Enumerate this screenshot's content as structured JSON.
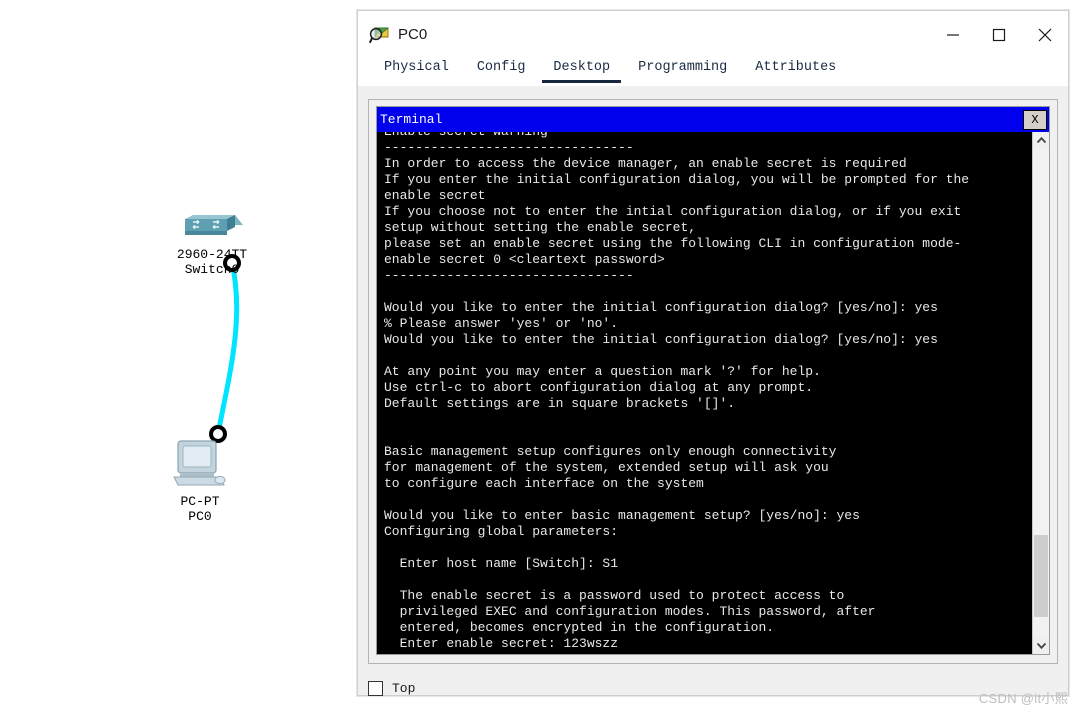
{
  "window": {
    "title": "PC0",
    "icon": "packet-tracer-inspect-icon",
    "minimize_label": "—",
    "maximize_label": "□",
    "close_label": "✕"
  },
  "tabs": [
    {
      "label": "Physical",
      "active": false
    },
    {
      "label": "Config",
      "active": false
    },
    {
      "label": "Desktop",
      "active": true
    },
    {
      "label": "Programming",
      "active": false
    },
    {
      "label": "Attributes",
      "active": false
    }
  ],
  "terminal": {
    "title": "Terminal",
    "close_label": "X",
    "background": "#000000",
    "titlebar_color": "#0000ee",
    "text_color": "#e8e8e8",
    "clipped_top_line": "Enable secret warning",
    "content": "--------------------------------\nIn order to access the device manager, an enable secret is required\nIf you enter the initial configuration dialog, you will be prompted for the\nenable secret\nIf you choose not to enter the intial configuration dialog, or if you exit\nsetup without setting the enable secret,\nplease set an enable secret using the following CLI in configuration mode-\nenable secret 0 <cleartext password>\n--------------------------------\n\nWould you like to enter the initial configuration dialog? [yes/no]: yes\n% Please answer 'yes' or 'no'.\nWould you like to enter the initial configuration dialog? [yes/no]: yes\n\nAt any point you may enter a question mark '?' for help.\nUse ctrl-c to abort configuration dialog at any prompt.\nDefault settings are in square brackets '[]'.\n\n\nBasic management setup configures only enough connectivity\nfor management of the system, extended setup will ask you\nto configure each interface on the system\n\nWould you like to enter basic management setup? [yes/no]: yes\nConfiguring global parameters:\n\n  Enter host name [Switch]: S1\n\n  The enable secret is a password used to protect access to\n  privileged EXEC and configuration modes. This password, after\n  entered, becomes encrypted in the configuration.\n  Enter enable secret: 123wszz",
    "scrollbar": {
      "up_arrow": "⌃",
      "down_arrow": "⌄",
      "thumb_position_pct": 79
    }
  },
  "bottom": {
    "checkbox_label": "Top",
    "checkbox_checked": false
  },
  "workspace": {
    "devices": [
      {
        "id": "switch",
        "icon": "switch-icon",
        "model": "2960-24TT",
        "name": "Switch0"
      },
      {
        "id": "pc",
        "icon": "pc-desktop-icon",
        "model": "PC-PT",
        "name": "PC0"
      }
    ],
    "link": {
      "type": "copper-straight-through",
      "color": "#00e5ff",
      "endpoint_marker": "link-status-up"
    }
  },
  "watermark": {
    "text": "CSDN @it小熙"
  }
}
